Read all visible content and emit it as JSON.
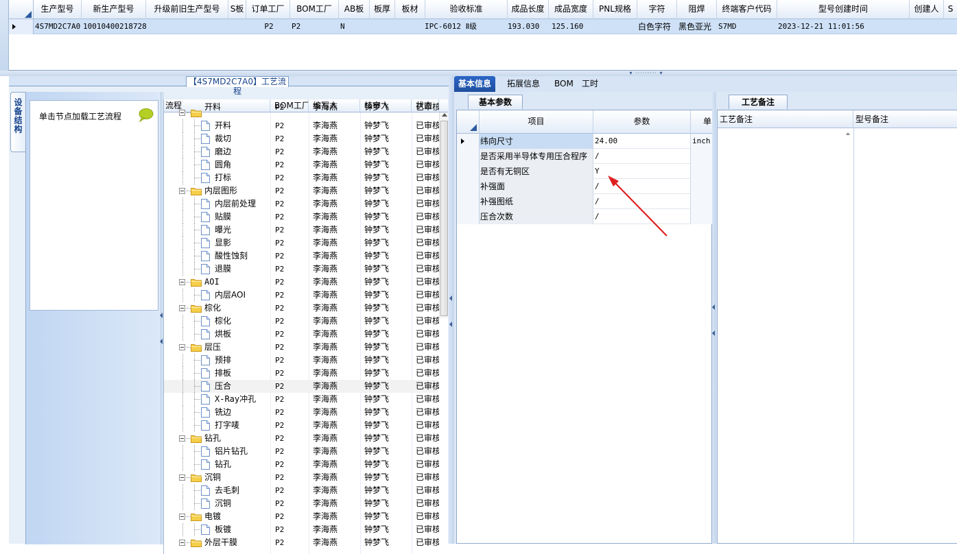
{
  "top_grid": {
    "headers": [
      "生产型号",
      "新生产型号",
      "升级前旧生产型号",
      "S板",
      "订单工厂",
      "BOM工厂",
      "AB板",
      "板厚",
      "板材",
      "验收标准",
      "成品长度",
      "成品宽度",
      "PNL规格",
      "字符",
      "阻焊",
      "终端客户代码",
      "型号创建时间",
      "创建人",
      "S"
    ],
    "row": {
      "model": "4S7MD2C7A0",
      "new_model": "10010400218728",
      "old_model": "",
      "s_board": "",
      "order_factory": "P2",
      "bom_factory": "P2",
      "ab_board": "N",
      "thickness": "",
      "material": "",
      "standard": "IPC-6012 Ⅱ级",
      "length": "193.030",
      "width": "125.160",
      "pnl": "",
      "legend": "白色字符",
      "solder": "黑色亚光",
      "customer": "S7MD",
      "created": "2023-12-21 11:01:56",
      "creator": ""
    }
  },
  "left_panel": {
    "title": "【4S7MD2C7A0】工艺流程",
    "side_tab": "设备结构",
    "node_hint": "单击节点加载工艺流程",
    "tree_headers": [
      "流程",
      "BOM工厂",
      "编写人",
      "核审人",
      "状态"
    ],
    "tree_rows": [
      {
        "label": "开料",
        "level": 0,
        "folder": true,
        "bom": "P2",
        "author": "李海燕",
        "reviewer": "钟梦飞",
        "status": "已审核",
        "partial": true
      },
      {
        "label": "开料",
        "level": 1,
        "bom": "P2",
        "author": "李海燕",
        "reviewer": "钟梦飞",
        "status": "已审核"
      },
      {
        "label": "裁切",
        "level": 1,
        "bom": "P2",
        "author": "李海燕",
        "reviewer": "钟梦飞",
        "status": "已审核"
      },
      {
        "label": "磨边",
        "level": 1,
        "bom": "P2",
        "author": "李海燕",
        "reviewer": "钟梦飞",
        "status": "已审核"
      },
      {
        "label": "圆角",
        "level": 1,
        "bom": "P2",
        "author": "李海燕",
        "reviewer": "钟梦飞",
        "status": "已审核"
      },
      {
        "label": "打标",
        "level": 1,
        "bom": "P2",
        "author": "李海燕",
        "reviewer": "钟梦飞",
        "status": "已审核"
      },
      {
        "label": "内层图形",
        "level": 0,
        "folder": true,
        "bom": "P2",
        "author": "李海燕",
        "reviewer": "钟梦飞",
        "status": "已审核"
      },
      {
        "label": "内层前处理",
        "level": 1,
        "bom": "P2",
        "author": "李海燕",
        "reviewer": "钟梦飞",
        "status": "已审核"
      },
      {
        "label": "贴膜",
        "level": 1,
        "bom": "P2",
        "author": "李海燕",
        "reviewer": "钟梦飞",
        "status": "已审核"
      },
      {
        "label": "曝光",
        "level": 1,
        "bom": "P2",
        "author": "李海燕",
        "reviewer": "钟梦飞",
        "status": "已审核"
      },
      {
        "label": "显影",
        "level": 1,
        "bom": "P2",
        "author": "李海燕",
        "reviewer": "钟梦飞",
        "status": "已审核"
      },
      {
        "label": "酸性蚀刻",
        "level": 1,
        "bom": "P2",
        "author": "李海燕",
        "reviewer": "钟梦飞",
        "status": "已审核"
      },
      {
        "label": "退膜",
        "level": 1,
        "bom": "P2",
        "author": "李海燕",
        "reviewer": "钟梦飞",
        "status": "已审核"
      },
      {
        "label": "AOI",
        "level": 0,
        "folder": true,
        "bom": "P2",
        "author": "李海燕",
        "reviewer": "钟梦飞",
        "status": "已审核"
      },
      {
        "label": "内层AOI",
        "level": 1,
        "bom": "P2",
        "author": "李海燕",
        "reviewer": "钟梦飞",
        "status": "已审核"
      },
      {
        "label": "棕化",
        "level": 0,
        "folder": true,
        "bom": "P2",
        "author": "李海燕",
        "reviewer": "钟梦飞",
        "status": "已审核"
      },
      {
        "label": "棕化",
        "level": 1,
        "bom": "P2",
        "author": "李海燕",
        "reviewer": "钟梦飞",
        "status": "已审核"
      },
      {
        "label": "烘板",
        "level": 1,
        "bom": "P2",
        "author": "李海燕",
        "reviewer": "钟梦飞",
        "status": "已审核"
      },
      {
        "label": "层压",
        "level": 0,
        "folder": true,
        "bom": "P2",
        "author": "李海燕",
        "reviewer": "钟梦飞",
        "status": "已审核"
      },
      {
        "label": "预排",
        "level": 1,
        "bom": "P2",
        "author": "李海燕",
        "reviewer": "钟梦飞",
        "status": "已审核"
      },
      {
        "label": "排板",
        "level": 1,
        "bom": "P2",
        "author": "李海燕",
        "reviewer": "钟梦飞",
        "status": "已审核"
      },
      {
        "label": "压合",
        "level": 1,
        "bom": "P2",
        "author": "李海燕",
        "reviewer": "钟梦飞",
        "status": "已审核",
        "selected": true
      },
      {
        "label": "X-Ray冲孔",
        "level": 1,
        "bom": "P2",
        "author": "李海燕",
        "reviewer": "钟梦飞",
        "status": "已审核"
      },
      {
        "label": "铣边",
        "level": 1,
        "bom": "P2",
        "author": "李海燕",
        "reviewer": "钟梦飞",
        "status": "已审核"
      },
      {
        "label": "打字唛",
        "level": 1,
        "bom": "P2",
        "author": "李海燕",
        "reviewer": "钟梦飞",
        "status": "已审核"
      },
      {
        "label": "钻孔",
        "level": 0,
        "folder": true,
        "bom": "P2",
        "author": "李海燕",
        "reviewer": "钟梦飞",
        "status": "已审核"
      },
      {
        "label": "铝片钻孔",
        "level": 1,
        "bom": "P2",
        "author": "李海燕",
        "reviewer": "钟梦飞",
        "status": "已审核"
      },
      {
        "label": "钻孔",
        "level": 1,
        "bom": "P2",
        "author": "李海燕",
        "reviewer": "钟梦飞",
        "status": "已审核"
      },
      {
        "label": "沉铜",
        "level": 0,
        "folder": true,
        "bom": "P2",
        "author": "李海燕",
        "reviewer": "钟梦飞",
        "status": "已审核"
      },
      {
        "label": "去毛刺",
        "level": 1,
        "bom": "P2",
        "author": "李海燕",
        "reviewer": "钟梦飞",
        "status": "已审核"
      },
      {
        "label": "沉铜",
        "level": 1,
        "bom": "P2",
        "author": "李海燕",
        "reviewer": "钟梦飞",
        "status": "已审核"
      },
      {
        "label": "电镀",
        "level": 0,
        "folder": true,
        "bom": "P2",
        "author": "李海燕",
        "reviewer": "钟梦飞",
        "status": "已审核"
      },
      {
        "label": "板镀",
        "level": 1,
        "bom": "P2",
        "author": "李海燕",
        "reviewer": "钟梦飞",
        "status": "已审核"
      },
      {
        "label": "外层干膜",
        "level": 0,
        "folder": true,
        "bom": "P2",
        "author": "李海燕",
        "reviewer": "钟梦飞",
        "status": "已审核"
      }
    ]
  },
  "right_panel": {
    "tabs": [
      "基本信息",
      "拓展信息",
      "BOM",
      "工时"
    ],
    "active_tab": 0,
    "basic_tab": "基本参数",
    "basic_headers": [
      "项目",
      "参数",
      "单"
    ],
    "basic_rows": [
      {
        "item": "纬向尺寸",
        "value": "24.00",
        "unit": "inch",
        "selected": true
      },
      {
        "item": "是否采用半导体专用压合程序",
        "value": "/",
        "unit": ""
      },
      {
        "item": "是否有无铜区",
        "value": "Y",
        "unit": ""
      },
      {
        "item": "补强面",
        "value": "/",
        "unit": ""
      },
      {
        "item": "补强图纸",
        "value": "/",
        "unit": ""
      },
      {
        "item": "压合次数",
        "value": "/",
        "unit": ""
      }
    ],
    "note_tab": "工艺备注",
    "note_headers": [
      "工艺备注",
      "型号备注"
    ]
  },
  "colors": {
    "accent": "#1f4f9e",
    "annotation_arrow": "#e02020"
  }
}
